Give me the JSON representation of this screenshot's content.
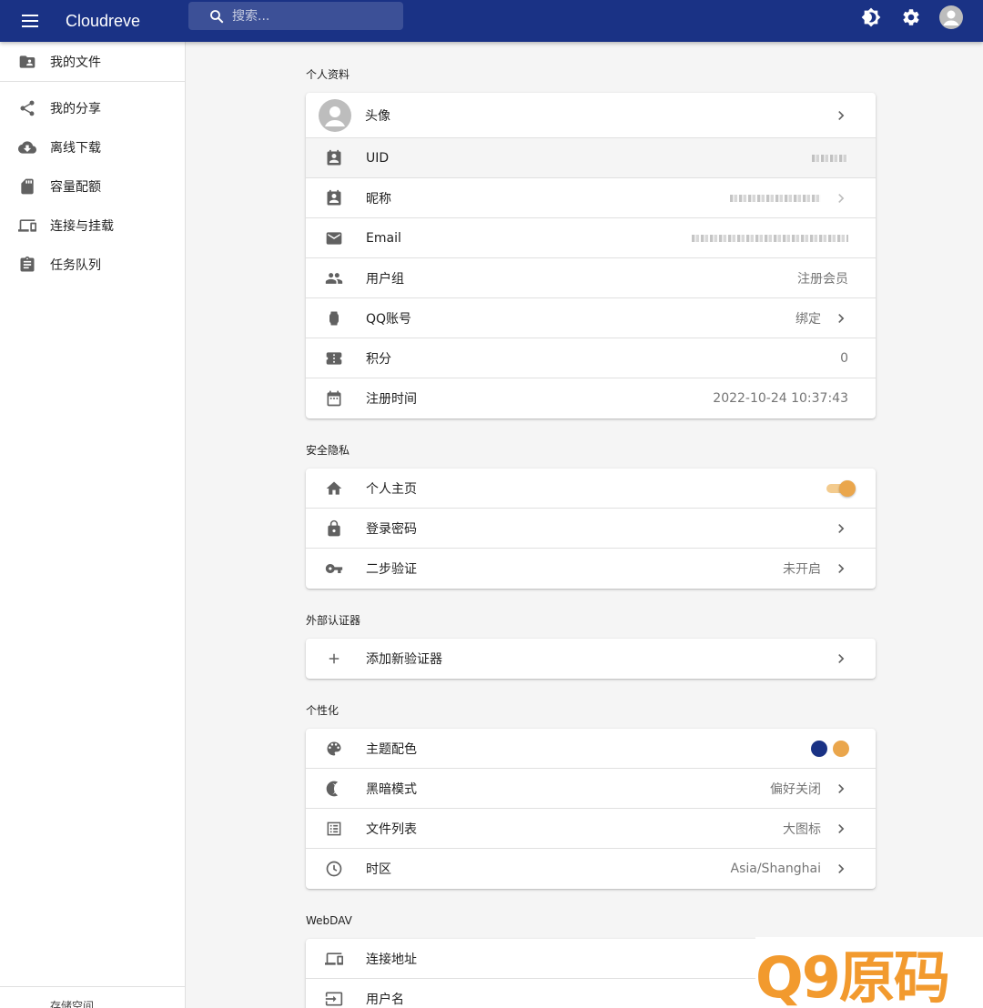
{
  "app": {
    "title": "Cloudreve"
  },
  "search": {
    "placeholder": "搜索..."
  },
  "sidebar": {
    "items": [
      {
        "label": "我的文件",
        "icon": "folder-account-icon"
      },
      {
        "label": "我的分享",
        "icon": "share-icon"
      },
      {
        "label": "离线下载",
        "icon": "cloud-download-icon"
      },
      {
        "label": "容量配额",
        "icon": "sd-card-icon"
      },
      {
        "label": "连接与挂载",
        "icon": "devices-icon"
      },
      {
        "label": "任务队列",
        "icon": "clipboard-icon"
      }
    ],
    "bottom_label": "存储空间"
  },
  "profile": {
    "title": "个人资料",
    "avatar_label": "头像",
    "uid_label": "UID",
    "nickname_label": "昵称",
    "email_label": "Email",
    "group_label": "用户组",
    "group_value": "注册会员",
    "qq_label": "QQ账号",
    "qq_value": "绑定",
    "points_label": "积分",
    "points_value": "0",
    "register_label": "注册时间",
    "register_value": "2022-10-24 10:37:43"
  },
  "security": {
    "title": "安全隐私",
    "homepage_label": "个人主页",
    "homepage_enabled": true,
    "password_label": "登录密码",
    "twofa_label": "二步验证",
    "twofa_value": "未开启"
  },
  "authenticator": {
    "title": "外部认证器",
    "add_label": "添加新验证器"
  },
  "personalize": {
    "title": "个性化",
    "theme_label": "主题配色",
    "theme_colors": [
      "#1a3285",
      "#eaa64c"
    ],
    "dark_label": "黑暗模式",
    "dark_value": "偏好关闭",
    "filelist_label": "文件列表",
    "filelist_value": "大图标",
    "timezone_label": "时区",
    "timezone_value": "Asia/Shanghai"
  },
  "webdav": {
    "title": "WebDAV",
    "url_label": "连接地址",
    "username_label": "用户名"
  },
  "watermark": {
    "text": "Q9原码"
  },
  "colors": {
    "appbar": "#1a3285",
    "accent": "#eaa64c"
  }
}
